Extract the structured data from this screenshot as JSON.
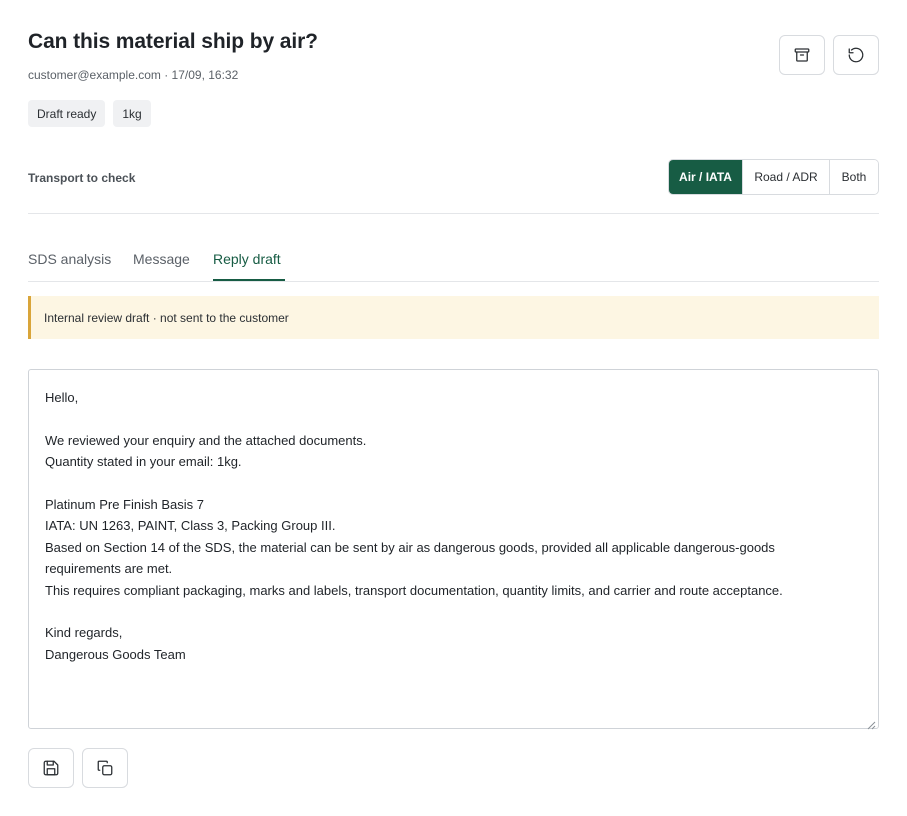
{
  "header": {
    "title": "Can this material ship by air?",
    "meta": "customer@example.com · 17/09, 16:32",
    "actions": {
      "archive_icon": "archive-icon",
      "restore_icon": "rotate-ccw-icon"
    }
  },
  "tags": [
    "Draft ready",
    "1kg"
  ],
  "transport": {
    "label": "Transport to check",
    "options": [
      "Air / IATA",
      "Road / ADR",
      "Both"
    ],
    "selected": "Air / IATA"
  },
  "tabs": [
    {
      "label": "SDS analysis",
      "active": false
    },
    {
      "label": "Message",
      "active": false
    },
    {
      "label": "Reply draft",
      "active": true
    }
  ],
  "notice": "Internal review draft · not sent to the customer",
  "draft": {
    "lines": [
      "Hello,",
      "",
      "We reviewed your enquiry and the attached documents.",
      "Quantity stated in your email: 1kg.",
      "",
      "Platinum Pre Finish Basis 7",
      "IATA: UN 1263, PAINT, Class 3, Packing Group III.",
      "Based on Section 14 of the SDS, the material can be sent by air as dangerous goods, provided all applicable dangerous-goods",
      "requirements are met.",
      "This requires compliant packaging, marks and labels, transport documentation, quantity limits, and carrier and route acceptance.",
      "",
      "Kind regards,",
      "Dangerous Goods Team"
    ]
  },
  "footer_actions": {
    "save_icon": "save-icon",
    "copy_icon": "copy-icon"
  },
  "colors": {
    "accent": "#175c44",
    "notice_bg": "#fdf6e3",
    "notice_border": "#d9a53a"
  }
}
